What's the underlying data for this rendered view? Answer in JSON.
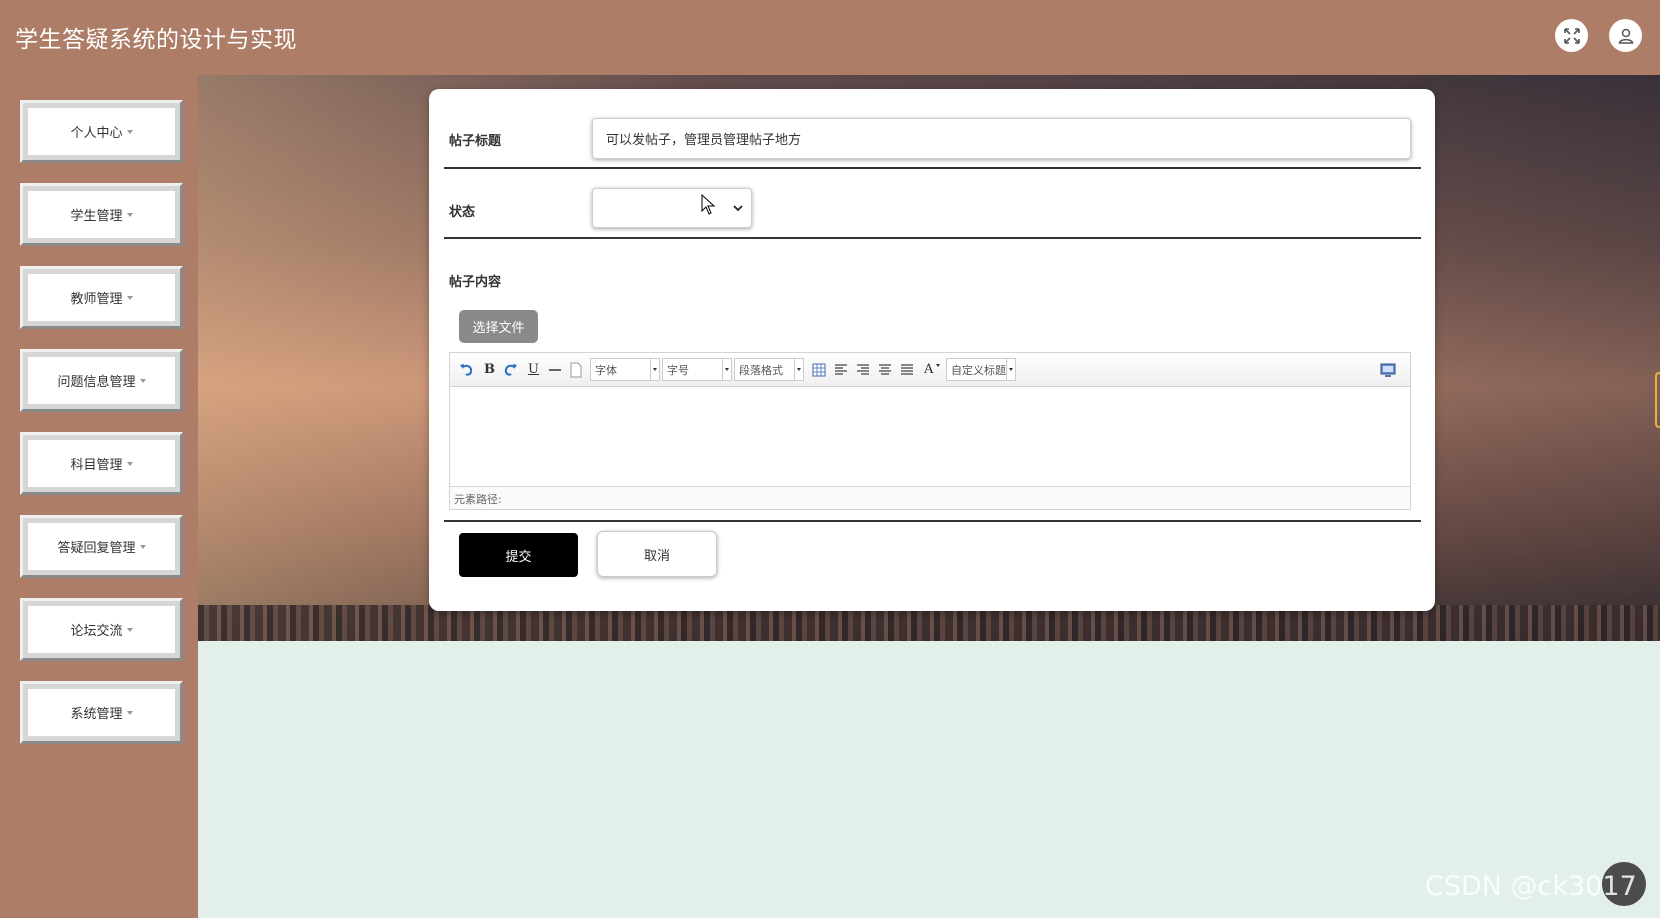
{
  "header": {
    "title": "学生答疑系统的设计与实现",
    "fullscreen_icon": "expand-icon",
    "user_icon": "user-icon"
  },
  "sidebar": {
    "items": [
      {
        "label": "个人中心"
      },
      {
        "label": "学生管理"
      },
      {
        "label": "教师管理"
      },
      {
        "label": "问题信息管理"
      },
      {
        "label": "科目管理"
      },
      {
        "label": "答疑回复管理"
      },
      {
        "label": "论坛交流"
      },
      {
        "label": "系统管理"
      }
    ]
  },
  "form": {
    "title_label": "帖子标题",
    "title_value": "可以发帖子，管理员管理帖子地方",
    "status_label": "状态",
    "status_value": "",
    "content_label": "帖子内容",
    "file_button": "选择文件",
    "submit_label": "提交",
    "cancel_label": "取消"
  },
  "editor": {
    "font_select": "字体",
    "size_select": "字号",
    "paragraph_select": "段落格式",
    "custom_title_select": "自定义标题",
    "element_path": "元素路径:"
  },
  "watermark": "CSDN @ck3017",
  "colors": {
    "header_bg": "#ae7d68",
    "page_bg": "#e3efe9",
    "submit_bg": "#000000",
    "file_btn_bg": "#8a8a8a"
  }
}
